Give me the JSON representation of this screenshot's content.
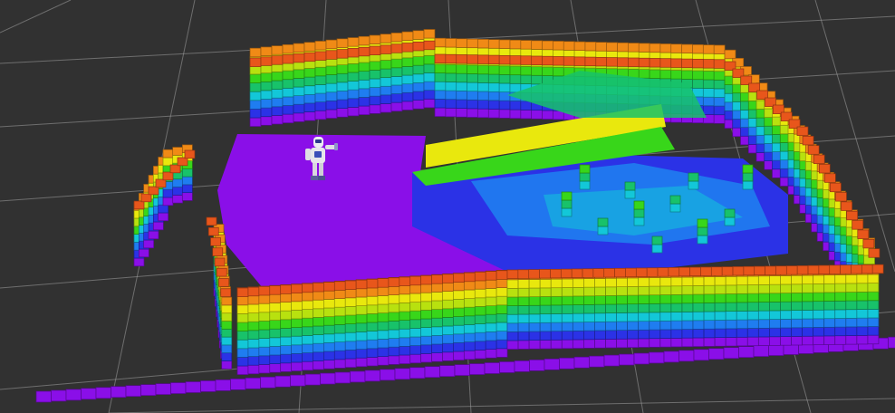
{
  "viewer": {
    "background_color": "#313131",
    "grid_color": "#a0a0a0"
  },
  "octomap": {
    "color_mode": "height",
    "height_colormap": [
      "#8a0fe8",
      "#2b32e6",
      "#1f7df0",
      "#13c7d8",
      "#18c26a",
      "#38d61a",
      "#b8e10f",
      "#e9e80d",
      "#f08a16",
      "#e8561b"
    ]
  },
  "robot_model": {
    "icon": "humanoid-robot-icon",
    "body_color": "#e6e6ea",
    "accent_color": "#3a4fb8"
  }
}
